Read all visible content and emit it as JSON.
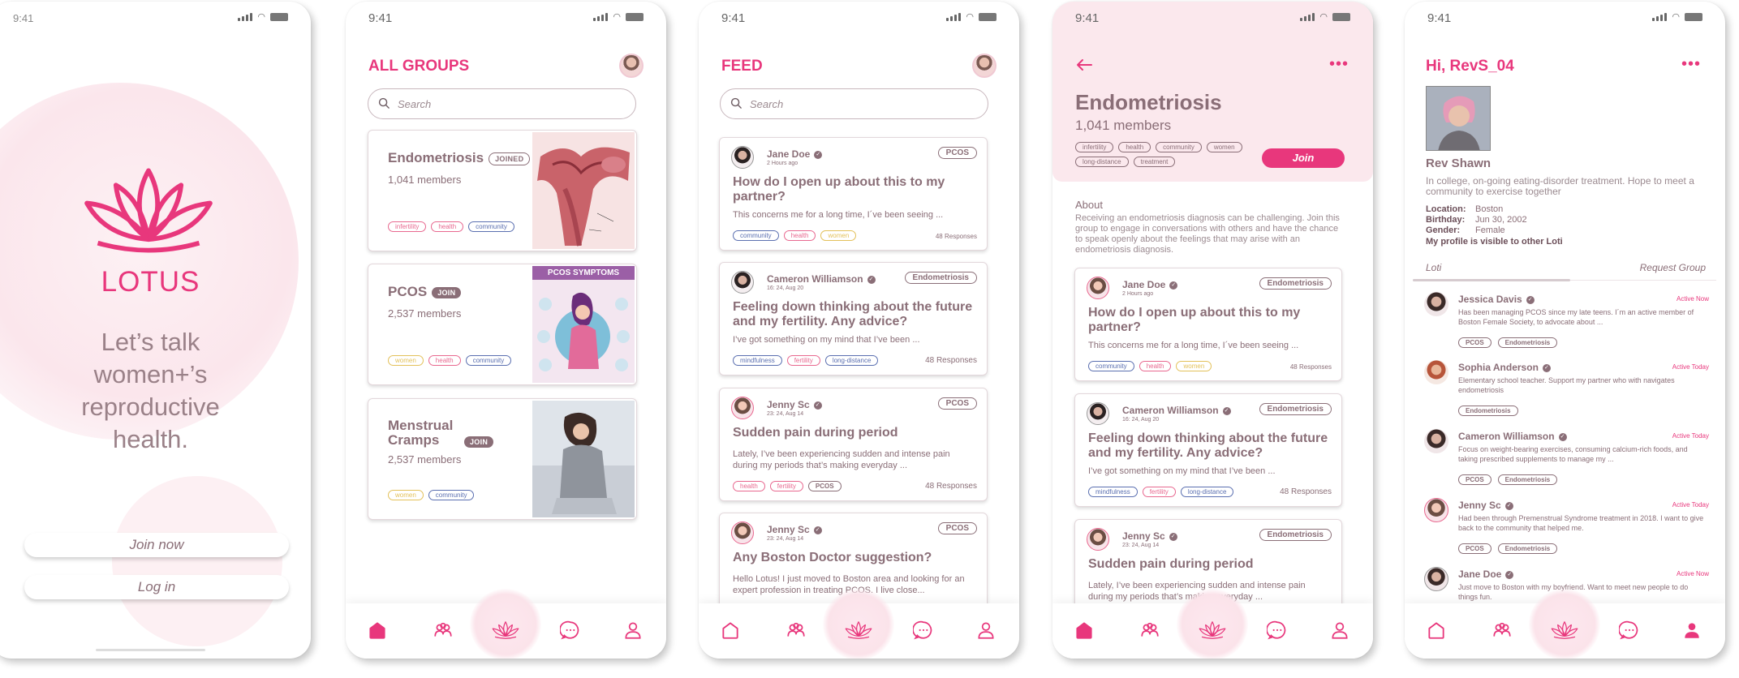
{
  "status_time": "9:41",
  "screen1": {
    "brand": "LOTUS",
    "tagline": "Let’s talk women+’s reproductive health.",
    "join_button": "Join now",
    "login_button": "Log in"
  },
  "screen2": {
    "title": "ALL GROUPS",
    "search_placeholder": "Search",
    "groups": [
      {
        "name": "Endometriosis",
        "badge": "JOINED",
        "members": "1,041 members",
        "tags": [
          "infertility",
          "health",
          "community"
        ]
      },
      {
        "name": "PCOS",
        "badge": "JOIN",
        "members": "2,537 members",
        "tags": [
          "women",
          "health",
          "community"
        ],
        "image_caption": "PCOS SYMPTOMS"
      },
      {
        "name": "Menstrual Cramps",
        "badge": "JOIN",
        "members": "2,537 members",
        "tags": [
          "women",
          "community"
        ]
      }
    ]
  },
  "screen3": {
    "title": "FEED",
    "search_placeholder": "Search",
    "posts": [
      {
        "author": "Jane Doe",
        "time": "2 Hours ago",
        "group": "PCOS",
        "title": "How do I open up about this to my partner?",
        "body": "This concerns me for a long time, I´ve been seeing ...",
        "tags": [
          "community",
          "health",
          "women"
        ],
        "responses": "48 Responses"
      },
      {
        "author": "Cameron Williamson",
        "time": "16: 24, Aug 20",
        "group": "Endometriosis",
        "title": "Feeling down thinking about the future and my fertility. Any advice?",
        "body": "I’ve got something on my mind that I’ve been ...",
        "tags": [
          "mindfulness",
          "fertility",
          "long-distance"
        ],
        "responses": "48 Responses"
      },
      {
        "author": "Jenny Sc",
        "time": "23: 24, Aug 14",
        "group": "PCOS",
        "title": "Sudden pain during period",
        "body": "Lately, I’ve been experiencing sudden and intense pain during my periods that’s making everyday ...",
        "tags": [
          "health",
          "fertility",
          "PCOS"
        ],
        "responses": "48 Responses"
      },
      {
        "author": "Jenny Sc",
        "time": "23: 24, Aug 14",
        "group": "PCOS",
        "title": "Any Boston Doctor suggestion?",
        "body": "Hello Lotus! I just moved to Boston area and looking for an expert profession in treating PCOS. I live close..."
      }
    ]
  },
  "screen4": {
    "name": "Endometriosis",
    "members": "1,041 members",
    "tags": [
      "infertility",
      "health",
      "community",
      "women",
      "long-distance",
      "treatment"
    ],
    "join_button": "Join",
    "about_label": "About",
    "about_text": "Receiving an endometriosis diagnosis can be challenging. Join this group to engage in conversations with others and have the chance to speak openly about the feelings that may arise with an endometriosis diagnosis.",
    "posts": [
      {
        "author": "Jane Doe",
        "time": "2 Hours ago",
        "group": "Endometriosis",
        "title": "How do I open up about this to my partner?",
        "body": "This concerns me for a long time, I´ve been seeing ...",
        "tags": [
          "community",
          "health",
          "women"
        ],
        "responses": "48 Responses"
      },
      {
        "author": "Cameron Williamson",
        "time": "16: 24, Aug 20",
        "group": "Endometriosis",
        "title": "Feeling down thinking about the future and my fertility. Any advice?",
        "body": "I’ve got something on my mind that I’ve been ...",
        "tags": [
          "mindfulness",
          "fertility",
          "long-distance"
        ],
        "responses": "48 Responses"
      },
      {
        "author": "Jenny Sc",
        "time": "23: 24, Aug 14",
        "group": "Endometriosis",
        "title": "Sudden pain during period",
        "body": "Lately, I’ve been experiencing sudden and intense pain during my periods that’s making everyday ..."
      }
    ]
  },
  "screen5": {
    "greeting": "Hi, RevS_04",
    "name": "Rev Shawn",
    "bio": "In college, on-going eating-disorder treatment. Hope to meet a community to exercise together",
    "location_label": "Location:",
    "location": "Boston",
    "birthday_label": "Birthday:",
    "birthday": "Jun 30, 2002",
    "gender_label": "Gender:",
    "gender": "Female",
    "visibility": "My profile is visible to other Loti",
    "tab_loti": "Loti",
    "tab_request": "Request Group",
    "members": [
      {
        "name": "Jessica Davis",
        "active": "Active Now",
        "desc": "Has been managing PCOS since my late teens. I´m an active member of Boston Female Society, to advocate about ...",
        "tags": [
          "PCOS",
          "Endometriosis"
        ]
      },
      {
        "name": "Sophia Anderson",
        "active": "Active Today",
        "desc": "Elementary school teacher. Support my partner who with navigates endometriosis",
        "tags": [
          "Endometriosis"
        ]
      },
      {
        "name": "Cameron Williamson",
        "active": "Active Today",
        "desc": "Focus on weight-bearing exercises, consuming calcium-rich foods, and taking prescribed supplements to manage my ...",
        "tags": [
          "PCOS",
          "Endometriosis"
        ]
      },
      {
        "name": "Jenny Sc",
        "active": "Active Today",
        "desc": "Had been through Premenstrual Syndrome treatment in 2018. I want to give back to the community that helped me.",
        "tags": [
          "PCOS",
          "Endometriosis"
        ]
      },
      {
        "name": "Jane Doe",
        "active": "Active Now",
        "desc": "Just move to Boston with my boyfriend. Want to meet new people to do things fun."
      }
    ]
  },
  "colors": {
    "accent": "#e8377c",
    "text": "#8a6e77",
    "glow": "#fbe3ea"
  },
  "tab_icons": [
    "home-icon",
    "groups-icon",
    "lotus-icon",
    "chat-icon",
    "profile-icon"
  ]
}
